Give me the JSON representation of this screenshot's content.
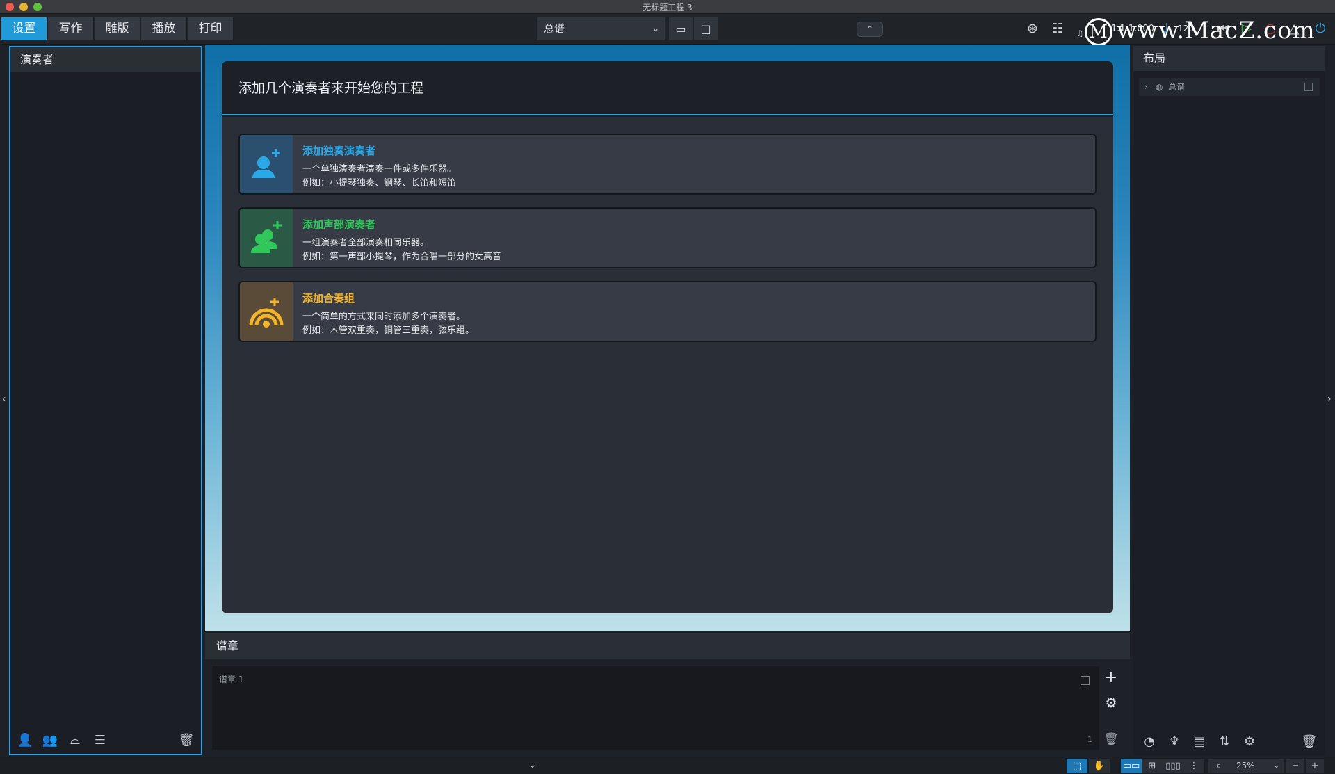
{
  "window": {
    "title": "无标题工程 3"
  },
  "toolbar": {
    "modes": [
      "设置",
      "写作",
      "雕版",
      "播放",
      "打印"
    ],
    "active_mode": "设置",
    "layout_select": "总谱",
    "time_position": "1.1.1.000",
    "tempo": "120"
  },
  "watermark": {
    "text": "www.MacZ.com"
  },
  "left_panel": {
    "title": "演奏者"
  },
  "center": {
    "heading": "添加几个演奏者来开始您的工程",
    "cards": [
      {
        "title": "添加独奏演奏者",
        "line1": "一个单独演奏者演奏一件或多件乐器。",
        "line2": "例如：小提琴独奏、钢琴、长笛和短笛",
        "color": "#2aa9e8",
        "icon_bg": "#2b4f6e"
      },
      {
        "title": "添加声部演奏者",
        "line1": "一组演奏者全部演奏相同乐器。",
        "line2": "例如：第一声部小提琴，作为合唱一部分的女高音",
        "color": "#30c85a",
        "icon_bg": "#2a5a45"
      },
      {
        "title": "添加合奏组",
        "line1": "一个简单的方式来同时添加多个演奏者。",
        "line2": "例如：木管双重奏，铜管三重奏，弦乐组。",
        "color": "#f2b42a",
        "icon_bg": "#5a4a38"
      }
    ]
  },
  "flows": {
    "title": "谱章",
    "items": [
      {
        "name": "谱章 1",
        "number": "1"
      }
    ]
  },
  "right_panel": {
    "title": "布局",
    "layouts": [
      {
        "name": "总谱"
      }
    ]
  },
  "statusbar": {
    "zoom": "25%"
  }
}
